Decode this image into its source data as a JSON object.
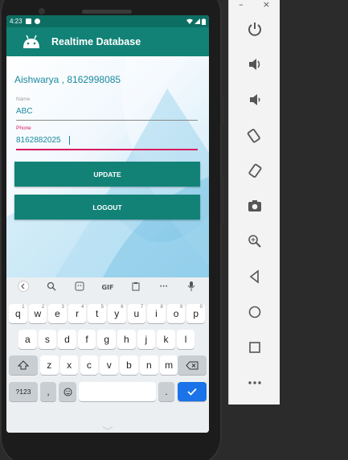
{
  "status_bar": {
    "time": "4:23"
  },
  "app_bar": {
    "title": "Realtime Database"
  },
  "greeting": "Aishwarya , 8162998085",
  "form": {
    "name_label": "Name",
    "name_value": "ABC",
    "phone_label": "Phone",
    "phone_value": "8162882025"
  },
  "buttons": {
    "update": "UPDATE",
    "logout": "LOGOUT"
  },
  "keyboard": {
    "suggestions": [
      "back-icon",
      "search-icon",
      "sticker-icon",
      "GIF",
      "clipboard-icon",
      "more-icon",
      "mic-icon"
    ],
    "gif_label": "GIF",
    "row1": [
      "q",
      "w",
      "e",
      "r",
      "t",
      "y",
      "u",
      "i",
      "o",
      "p"
    ],
    "row1_hints": [
      "1",
      "2",
      "3",
      "4",
      "5",
      "6",
      "7",
      "8",
      "9",
      "0"
    ],
    "row2": [
      "a",
      "s",
      "d",
      "f",
      "g",
      "h",
      "j",
      "k",
      "l"
    ],
    "row3": [
      "z",
      "x",
      "c",
      "v",
      "b",
      "n",
      "m"
    ],
    "symbols_label": "?123",
    "comma": ",",
    "period": "."
  },
  "emulator_panel": {
    "minimize": "–",
    "close": "×",
    "tools": [
      "power-icon",
      "volume-up-icon",
      "volume-down-icon",
      "rotate-left-icon",
      "rotate-right-icon",
      "camera-icon",
      "zoom-icon",
      "back-icon",
      "home-icon",
      "overview-icon",
      "more-icon"
    ]
  },
  "colors": {
    "primary": "#128277",
    "primary_dark": "#0d6e63",
    "accent": "#d81b60",
    "text_teal": "#1a8a9e"
  }
}
